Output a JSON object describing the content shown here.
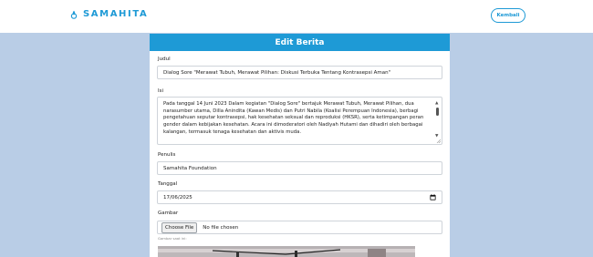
{
  "brand": {
    "name": "SAMAHITA",
    "accent": "#1e9ad6"
  },
  "nav": {
    "back_label": "Kembali"
  },
  "form": {
    "title": "Edit Berita",
    "judul": {
      "label": "Judul",
      "value": "Dialog Sore \"Merawat Tubuh, Merawat Pilihan: Diskusi Terbuka Tentang Kontrasepsi Aman\""
    },
    "isi": {
      "label": "Isi",
      "value": "Pada tanggal 14 Juni 2023 Dalam kegiatan \"Dialog Sore\" bertajuk Merawat Tubuh, Merawat Pilihan, dua narasumber utama, Dilla Anindita (Kawan Medis) dan Putri Nabila (Koalisi Perempuan Indonesia), berbagi pengetahuan seputar kontrasepsi, hak kesehatan seksual dan reproduksi (HKSR), serta ketimpangan peran gender dalam kebijakan kesehatan. Acara ini dimoderatori oleh Nadiyah Hutami dan dihadiri oleh berbagai kalangan, termasuk tenaga kesehatan dan aktivis muda."
    },
    "penulis": {
      "label": "Penulis",
      "value": "Samahita Foundation"
    },
    "tanggal": {
      "label": "Tanggal",
      "value": "17/06/2025"
    },
    "gambar": {
      "label": "Gambar",
      "button_label": "Choose File",
      "file_status": "No file chosen",
      "hint": "Gambar saat ini:"
    }
  },
  "colors": {
    "page_bg": "#b9cde6",
    "header_bg": "#1e9ad6"
  }
}
